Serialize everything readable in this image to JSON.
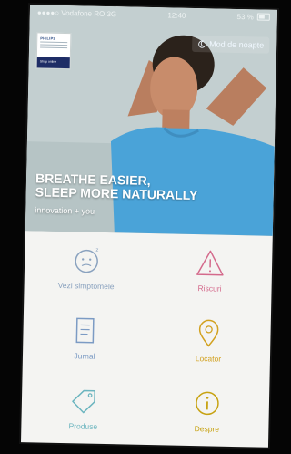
{
  "status_bar": {
    "carrier": "●●●●○ Vodafone RO",
    "network": "3G",
    "time": "12:40",
    "battery": "53 %"
  },
  "header": {
    "logo_brand": "PHILIPS",
    "logo_button": "Shop online",
    "night_mode_label": "Mod de noapte"
  },
  "hero": {
    "headline": "BREATHE EASIER,\nSLEEP MORE NATURALLY",
    "tagline": "innovation + you"
  },
  "menu": [
    {
      "label": "Vezi simptomele",
      "icon": "symptoms-face-icon",
      "color": "#8aa2bf"
    },
    {
      "label": "Riscuri",
      "icon": "warning-triangle-icon",
      "color": "#d46a8c"
    },
    {
      "label": "Jurnal",
      "icon": "journal-document-icon",
      "color": "#7c9bc4"
    },
    {
      "label": "Locator",
      "icon": "location-pin-icon",
      "color": "#d2a11f"
    },
    {
      "label": "Produse",
      "icon": "product-tag-icon",
      "color": "#6cb5bf"
    },
    {
      "label": "Despre",
      "icon": "info-icon",
      "color": "#c7a211"
    }
  ],
  "colors": {
    "hero_shirt": "#4aa3d8",
    "screen_bg": "#f4f4f2"
  }
}
